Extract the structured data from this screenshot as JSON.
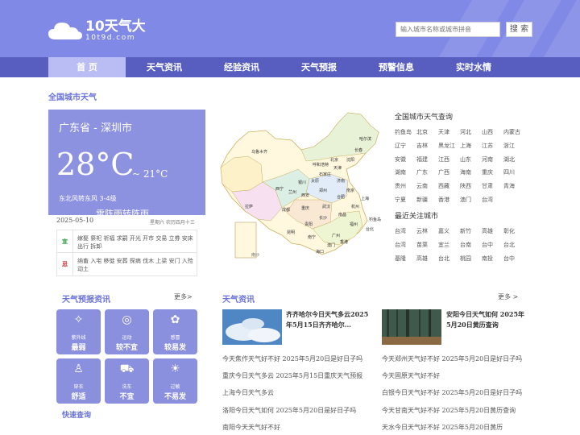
{
  "header": {
    "logo_title": "10天气大",
    "logo_sub": "10t9d.com",
    "search_placeholder": "输入城市名称或城市拼音",
    "search_button": "搜 索",
    "bg_color": "#8189e6"
  },
  "nav": {
    "items": [
      "首 页",
      "天气资讯",
      "经验资讯",
      "天气预报",
      "预警信息",
      "实时水情"
    ],
    "active_index": 0
  },
  "weather": {
    "section_title": "全国城市天气",
    "city": "广东省 - 深圳市",
    "temp": "28°C",
    "low": "~ 21°C",
    "wind": "东北风转东风 3-4级",
    "condition": "雷阵雨转阵雨",
    "date": "2025-05-10",
    "lunar": "星期六 农历四月十三"
  },
  "almanac": {
    "yi_label": "宜",
    "yi_text": "嫁娶 祭祀 祈福 求嗣 开光 开市 交易 立券 安床 出行 拆卸",
    "ji_label": "忌",
    "ji_text": "纳畜 入宅 移徙 安葬 探病 伐木 上梁 安门 入殓 动土"
  },
  "map": {
    "provinces": [
      "乌鲁木齐",
      "哈尔滨",
      "长春",
      "沈阳",
      "北京",
      "天津",
      "呼和浩特",
      "石家庄",
      "济南",
      "太原",
      "银川",
      "兰州",
      "西宁",
      "西安",
      "郑州",
      "南京",
      "合肥",
      "上海",
      "成都",
      "武汉",
      "杭州",
      "重庆",
      "南昌",
      "长沙",
      "福州",
      "贵阳",
      "昆明",
      "台北",
      "广州",
      "南宁",
      "海口",
      "拉萨",
      "香港",
      "澳门",
      "钓鱼岛"
    ],
    "inset_label": "南沙"
  },
  "city_query": {
    "title": "全国城市天气查询",
    "cities": [
      "钓鱼岛",
      "北京",
      "天津",
      "河北",
      "山西",
      "内蒙古",
      "辽宁",
      "吉林",
      "黑龙江",
      "上海",
      "江苏",
      "浙江",
      "安徽",
      "福建",
      "江西",
      "山东",
      "河南",
      "湖北",
      "湖南",
      "广东",
      "广西",
      "海南",
      "重庆",
      "四川",
      "贵州",
      "云南",
      "西藏",
      "陕西",
      "甘肃",
      "青海",
      "宁夏",
      "新疆",
      "香港",
      "澳门",
      "台湾"
    ]
  },
  "hot_cities": {
    "title": "最近关注城市",
    "cities": [
      "台湾",
      "云林",
      "嘉义",
      "新竹",
      "高雄",
      "彰化",
      "台湾",
      "苗栗",
      "宜兰",
      "台南",
      "台中",
      "台北",
      "基隆",
      "高雄",
      "台北",
      "桃园",
      "南投",
      "台中"
    ]
  },
  "forecast_info": {
    "title": "天气预报资讯",
    "more": "更多>",
    "tiles": [
      {
        "icon": "uv-icon",
        "glyph": "✧",
        "sub": "紫外线",
        "val": "最弱"
      },
      {
        "icon": "sport-icon",
        "glyph": "◎",
        "sub": "运动",
        "val": "较不宜"
      },
      {
        "icon": "allergy-icon",
        "glyph": "✿",
        "sub": "感冒",
        "val": "较易发"
      },
      {
        "icon": "clothes-icon",
        "glyph": "♙",
        "sub": "穿衣",
        "val": "舒适"
      },
      {
        "icon": "carwash-icon",
        "glyph": "⛟",
        "sub": "洗车",
        "val": "不宜"
      },
      {
        "icon": "sun-icon",
        "glyph": "☀",
        "sub": "过敏",
        "val": "不易发"
      }
    ],
    "quick": "快速查询"
  },
  "news": {
    "title": "天气资讯",
    "more": "更多 >",
    "feature_left": "齐齐哈尔今日天气多云2025年5月15日齐齐哈尔...",
    "feature_right": "安阳今日天气如何 2025年5月20日黄历查询",
    "left": [
      "今天焦作天气好不好 2025年5月20日是好日子吗",
      "重庆今日天气多云 2025年5月15日重庆天气预报",
      "上海今日天气多云",
      "洛阳今日天气如何 2025年5月20日是好日子吗",
      "南阳今天天气好不好"
    ],
    "right": [
      "今天郑州天气好不好 2025年5月20日是好日子吗",
      "今天固原天气好不好",
      "白银今日天气好不好 2025年5月20日是好日子吗",
      "今天甘南天气好不好 2025年5月20日黄历查询",
      "天水今日天气好不好 2025年5月20日黄历"
    ]
  }
}
